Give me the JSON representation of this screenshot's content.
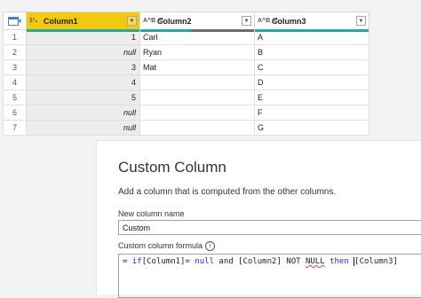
{
  "grid": {
    "columns": [
      {
        "type": "1²₃",
        "label": "Column1"
      },
      {
        "type": "A^B_C",
        "label": "Column2"
      },
      {
        "type": "A^B_C",
        "label": "Column3"
      }
    ],
    "rows": [
      {
        "n": "1",
        "c1": "1",
        "c2": "Carl",
        "c3": "A"
      },
      {
        "n": "2",
        "c1": "null",
        "c2": "Ryan",
        "c3": "B"
      },
      {
        "n": "3",
        "c1": "3",
        "c2": "Mat",
        "c3": "C"
      },
      {
        "n": "4",
        "c1": "4",
        "c2": "",
        "c3": "D"
      },
      {
        "n": "5",
        "c1": "5",
        "c2": "",
        "c3": "E"
      },
      {
        "n": "6",
        "c1": "null",
        "c2": "",
        "c3": "F"
      },
      {
        "n": "7",
        "c1": "null",
        "c2": "",
        "c3": "G"
      }
    ]
  },
  "dialog": {
    "title": "Custom Column",
    "subtitle": "Add a column that is computed from the other columns.",
    "name_label": "New column name",
    "name_value": "Custom",
    "formula_label": "Custom column formula",
    "formula": {
      "eq": "= ",
      "if": "if",
      "ref1": "[Column1]",
      "op": "= ",
      "null1": "null",
      "and": " and ",
      "ref2": "[Column2]",
      "not": " NOT ",
      "null2": "NULL",
      "then": " then ",
      "ref3": "[Column3]"
    }
  }
}
